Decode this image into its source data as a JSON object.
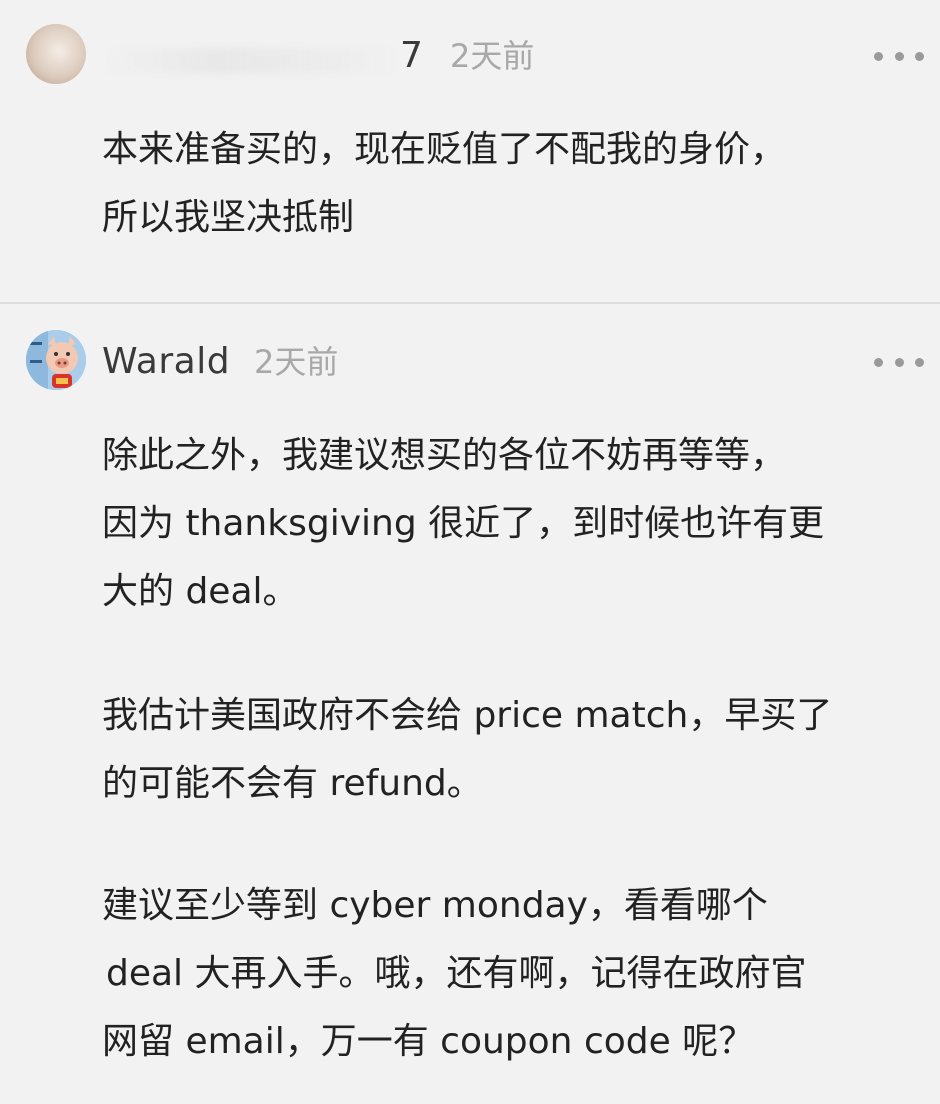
{
  "comments": [
    {
      "username_visible": "7",
      "time": "2天前",
      "text_lines": [
        "本来准备买的，现在贬值了不配我的身价，",
        "所以我坚决抵制"
      ]
    },
    {
      "username": "Warald",
      "time": "2天前",
      "paragraphs": [
        [
          "除此之外，我建议想买的各位不妨再等等，",
          "因为 thanksgiving 很近了，到时候也许有更",
          "大的 deal。"
        ],
        [
          "我估计美国政府不会给 price match，早买了",
          "的可能不会有 refund。"
        ],
        [
          "建议至少等到 cyber monday，看看哪个",
          "deal 大再入手。哦，还有啊，记得在政府官",
          "网留 email，万一有 coupon code 呢？"
        ]
      ]
    }
  ],
  "icons": {
    "more": "more-horizontal-icon"
  }
}
